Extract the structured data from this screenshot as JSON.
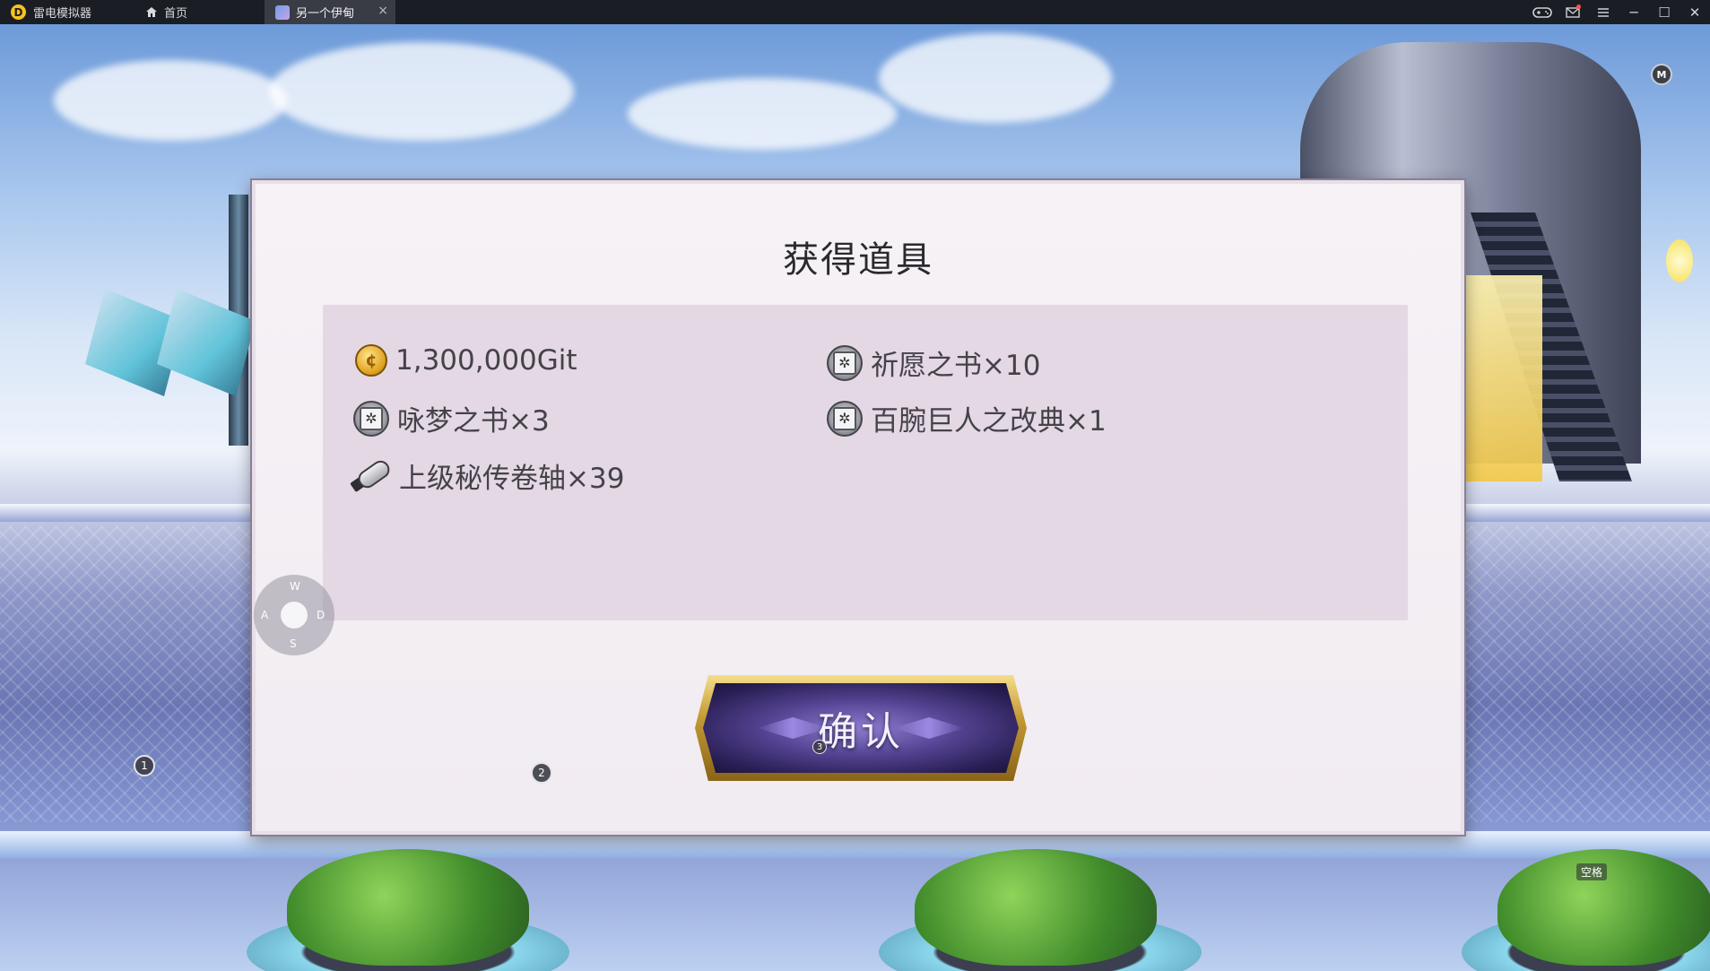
{
  "emulator": {
    "app_name": "雷电模拟器",
    "tabs": [
      {
        "label": "首页"
      },
      {
        "label": "另一个伊甸"
      }
    ],
    "tab_close_glyph": "×",
    "controls": {
      "gamepad_icon": "gamepad-icon",
      "mail_icon": "mail-icon",
      "menu_icon": "menu-icon",
      "minimize_glyph": "─",
      "maximize_glyph": "☐",
      "close_glyph": "✕"
    }
  },
  "dialog": {
    "title": "获得道具",
    "items": [
      {
        "icon": "gold-coin-icon",
        "text": "1,300,000Git"
      },
      {
        "icon": "book-icon",
        "text": "祈愿之书×10"
      },
      {
        "icon": "book-icon",
        "text": "咏梦之书×3"
      },
      {
        "icon": "book-icon",
        "text": "百腕巨人之改典×1"
      },
      {
        "icon": "scroll-icon",
        "text": "上级秘传卷轴×39"
      }
    ],
    "confirm_label": "确认"
  },
  "keymap": {
    "wasd": {
      "up": "W",
      "left": "A",
      "right": "D",
      "down": "S"
    },
    "markers": [
      "1",
      "2",
      "3"
    ],
    "space_label": "空格",
    "map_marker": "M"
  },
  "colors": {
    "titlebar": "#1b1d24",
    "active_tab": "#3a3c45",
    "dialog_bg": "#f4eff4",
    "items_panel": "#e0d4e0",
    "button_gold": "#c49a35",
    "button_purple": "#52418f"
  }
}
